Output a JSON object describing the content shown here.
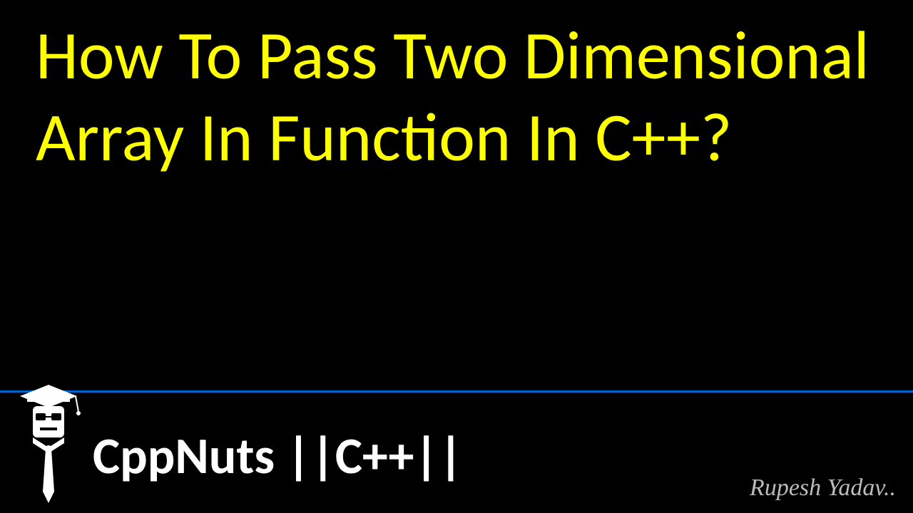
{
  "title": "How To Pass Two Dimensional Array In Function In C++?",
  "channel": "CppNuts ||C++||",
  "signature": "Rupesh Yadav..",
  "colors": {
    "background": "#000000",
    "title": "#ffff00",
    "channel": "#ffffff",
    "divider": "#0066cc",
    "signature": "#bbbbbb"
  }
}
